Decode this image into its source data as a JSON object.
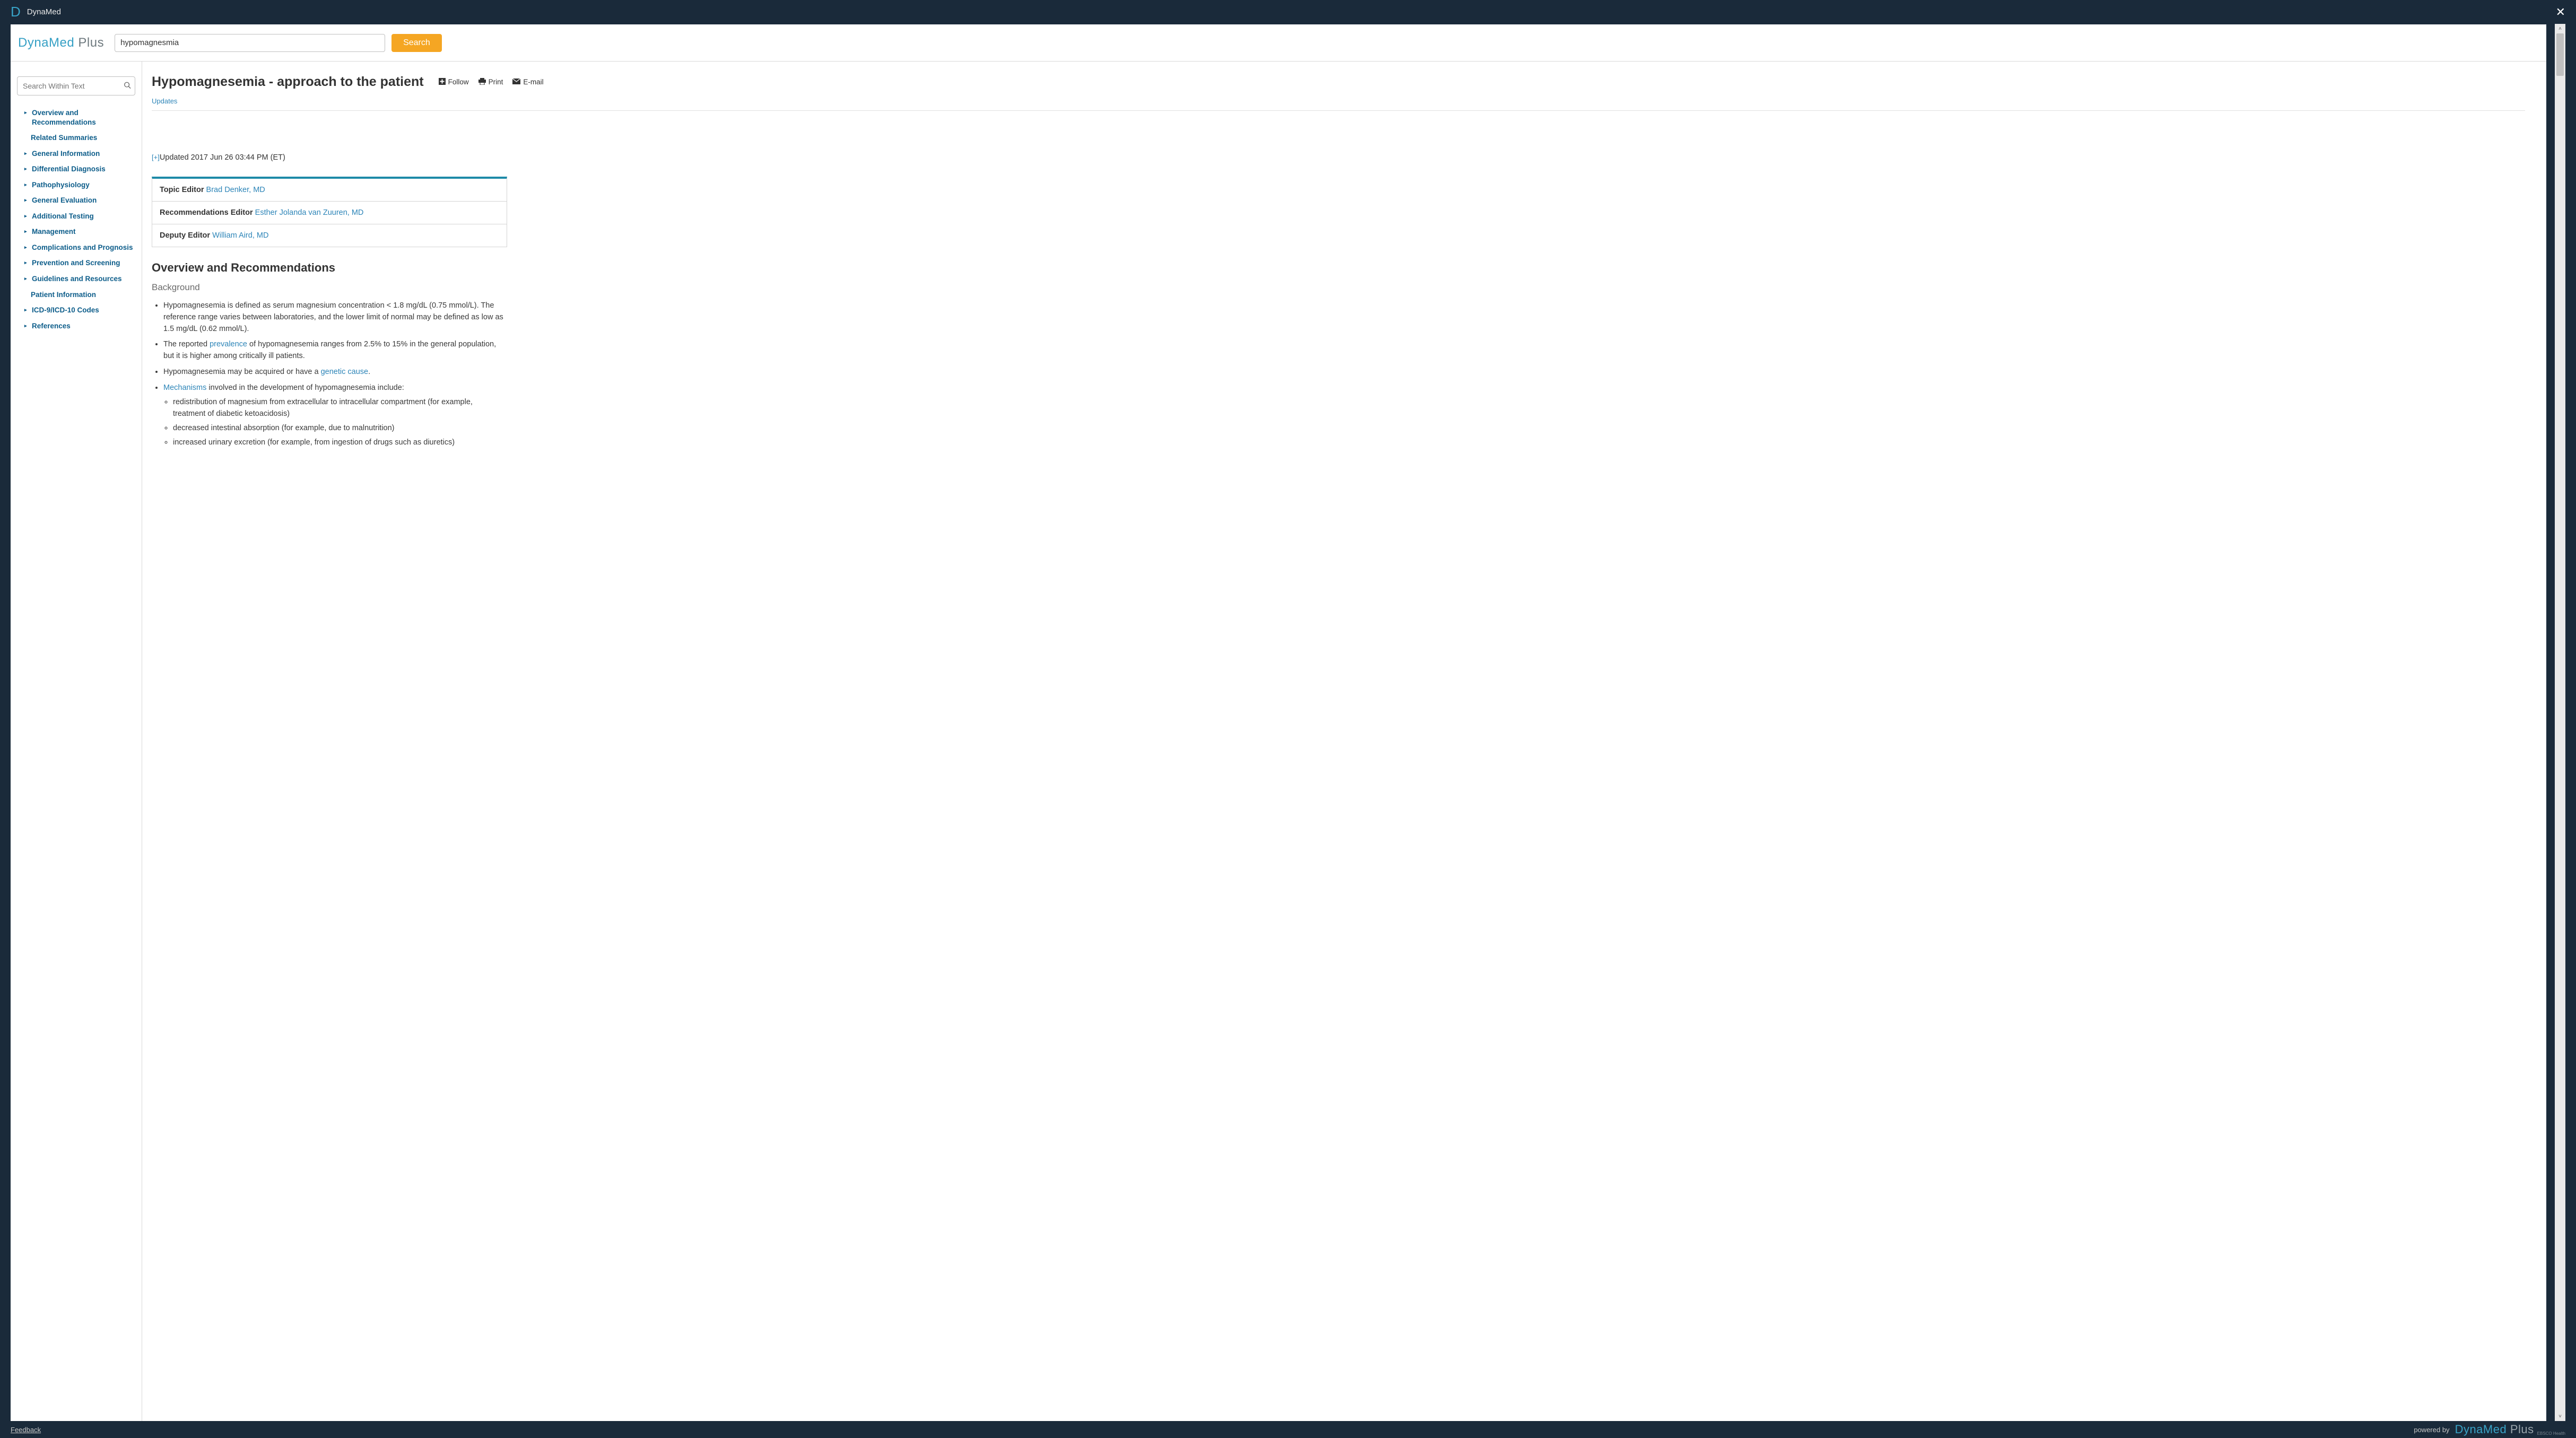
{
  "chrome": {
    "logo_letter": "D",
    "app_name": "DynaMed",
    "close_glyph": "✕"
  },
  "header": {
    "logo_main": "DynaMed",
    "logo_suffix": " Plus",
    "search_value": "hypomagnesmia",
    "search_button": "Search"
  },
  "sidebar": {
    "search_within_placeholder": "Search Within Text",
    "items": [
      {
        "label": "Overview and Recommendations",
        "has_children": true
      },
      {
        "label": "Related Summaries",
        "has_children": false
      },
      {
        "label": "General Information",
        "has_children": true
      },
      {
        "label": "Differential Diagnosis",
        "has_children": true
      },
      {
        "label": "Pathophysiology",
        "has_children": true
      },
      {
        "label": "General Evaluation",
        "has_children": true
      },
      {
        "label": "Additional Testing",
        "has_children": true
      },
      {
        "label": "Management",
        "has_children": true
      },
      {
        "label": "Complications and Prognosis",
        "has_children": true
      },
      {
        "label": "Prevention and Screening",
        "has_children": true
      },
      {
        "label": "Guidelines and Resources",
        "has_children": true
      },
      {
        "label": "Patient Information",
        "has_children": false
      },
      {
        "label": "ICD-9/ICD-10 Codes",
        "has_children": true
      },
      {
        "label": "References",
        "has_children": true
      }
    ]
  },
  "article": {
    "title": "Hypomagnesemia - approach to the patient",
    "actions": {
      "follow": "Follow",
      "print": "Print",
      "email": "E-mail"
    },
    "updates_link": "Updates",
    "expand_glyph": "[+]",
    "updated_text": "Updated 2017 Jun 26 03:44 PM (ET)",
    "editors": [
      {
        "role": "Topic Editor",
        "name": "Brad Denker, MD"
      },
      {
        "role": "Recommendations Editor",
        "name": "Esther Jolanda van Zuuren, MD"
      },
      {
        "role": "Deputy Editor",
        "name": "William Aird, MD"
      }
    ],
    "section_head": "Overview and Recommendations",
    "subhead": "Background",
    "bullets": {
      "b1": "Hypomagnesemia is defined as serum magnesium concentration < 1.8 mg/dL (0.75 mmol/L). The reference range varies between laboratories, and the lower limit of normal may be defined as low as 1.5 mg/dL (0.62 mmol/L).",
      "b2_pre": "The reported ",
      "b2_link": "prevalence",
      "b2_post": " of hypomagnesemia ranges from 2.5% to 15% in the general population, but it is higher among critically ill patients.",
      "b3_pre": "Hypomagnesemia may be acquired or have a ",
      "b3_link": "genetic cause",
      "b3_post": ".",
      "b4_link": "Mechanisms",
      "b4_post": " involved in the development of hypomagnesemia include:",
      "sub1": "redistribution of magnesium from extracellular to intracellular compartment (for example, treatment of diabetic ketoacidosis)",
      "sub2": "decreased intestinal absorption (for example, due to malnutrition)",
      "sub3": "increased urinary excretion (for example, from ingestion of drugs such as diuretics)"
    }
  },
  "footer": {
    "feedback": "Feedback",
    "powered_by": "powered by",
    "logo_main": "DynaMed",
    "logo_suffix": " Plus",
    "sublabel": "EBSCO Health"
  },
  "scroll": {
    "up": "˄",
    "down": "˅"
  }
}
